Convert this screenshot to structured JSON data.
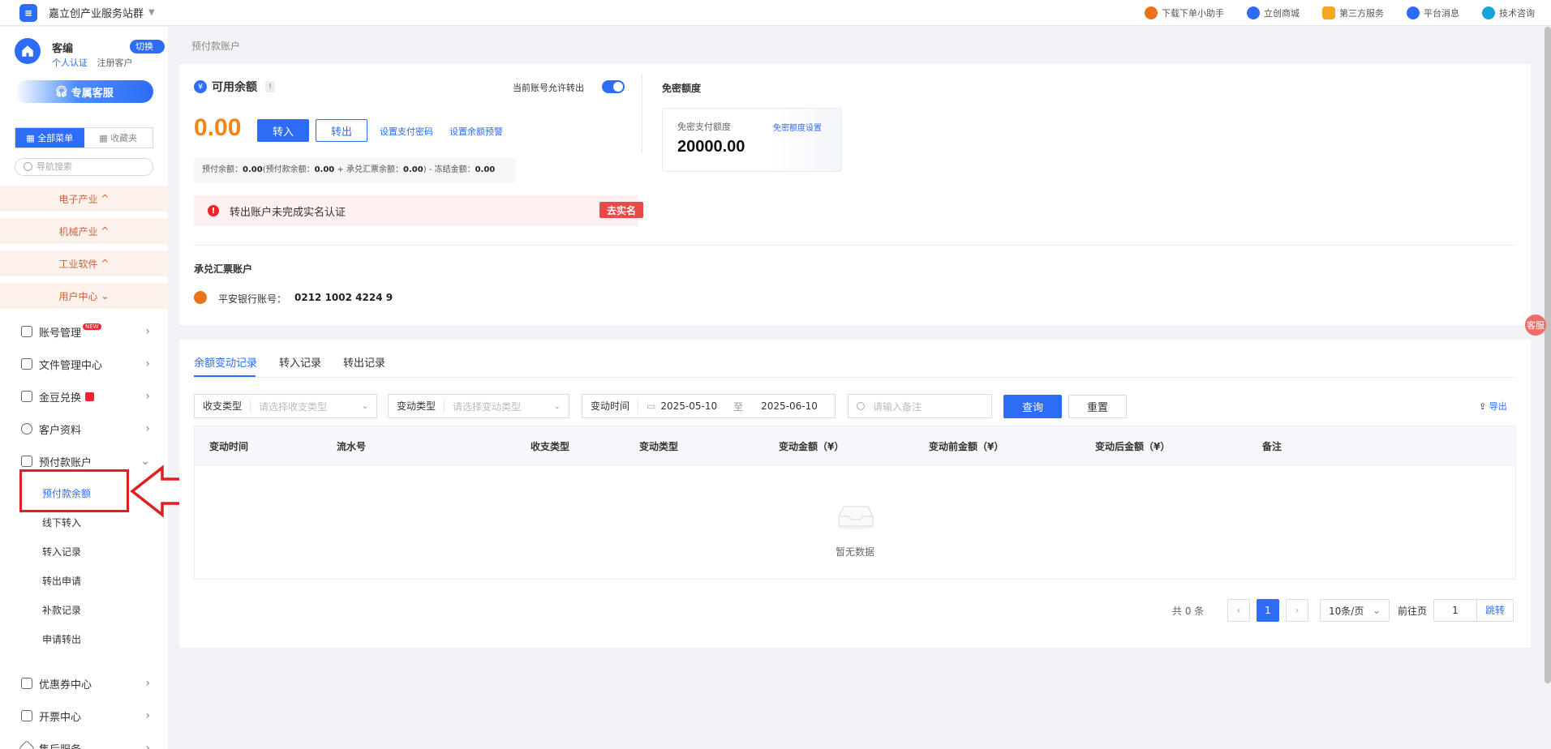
{
  "topbar": {
    "site_name": "嘉立创产业服务站群",
    "links": [
      {
        "label": "下载下单小助手",
        "color": "#e8741c",
        "icon": "assistant-icon"
      },
      {
        "label": "立创商城",
        "color": "#2d6cf6",
        "icon": "mall-icon"
      },
      {
        "label": "第三方服务",
        "color": "#f5a623",
        "icon": "apps-icon"
      },
      {
        "label": "平台消息",
        "color": "#2d6cf6",
        "icon": "bell-icon"
      },
      {
        "label": "技术咨询",
        "color": "#17a2d8",
        "icon": "chat-icon"
      }
    ]
  },
  "sidebar": {
    "user_name": "客编",
    "switch_label": "切换",
    "tag_personal": "个人认证",
    "tag_registered": "注册客户",
    "vip_label": "专属客服",
    "menu_all": "全部菜单",
    "menu_fav": "收藏夹",
    "search_placeholder": "导航搜索",
    "categories": [
      "电子产业",
      "机械产业",
      "工业软件",
      "用户中心"
    ],
    "items": [
      {
        "label": "账号管理",
        "badge": "NEW"
      },
      {
        "label": "文件管理中心"
      },
      {
        "label": "金豆兑换"
      },
      {
        "label": "客户资料"
      },
      {
        "label": "预付款账户"
      },
      {
        "label": "优惠券中心"
      },
      {
        "label": "开票中心"
      },
      {
        "label": "售后服务"
      }
    ],
    "sub_items": [
      "预付款余额",
      "线下转入",
      "转入记录",
      "转出申请",
      "补款记录",
      "申请转出"
    ]
  },
  "main": {
    "breadcrumb": "预付款账户",
    "available_title": "可用余额",
    "allow_transfer_label": "当前账号允许转出",
    "allow_transfer_on": true,
    "balance": "0.00",
    "transfer_in": "转入",
    "transfer_out": "转出",
    "set_pay_password": "设置支付密码",
    "set_balance_alert": "设置余额预警",
    "formula": {
      "p1": "预付余额：",
      "v1": "0.00",
      "p2": "(预付款余额：",
      "v2": "0.00",
      "p3": " + 承兑汇票余额：",
      "v3": "0.00",
      "p4": ") - 冻结金额：",
      "v4": "0.00"
    },
    "warning_text": "转出账户未完成实名认证",
    "verify_button": "去实名",
    "free_title": "免密额度",
    "free_label": "免密支付额度",
    "free_setting": "免密额度设置",
    "free_value": "20000.00",
    "acceptance_title": "承兑汇票账户",
    "bank_label": "平安银行账号：",
    "bank_no": "0212 1002 4224 9"
  },
  "records": {
    "tabs": [
      "余额变动记录",
      "转入记录",
      "转出记录"
    ],
    "filters": {
      "income_label": "收支类型",
      "income_placeholder": "请选择收支类型",
      "change_label": "变动类型",
      "change_placeholder": "请选择变动类型",
      "time_label": "变动时间",
      "date_from": "2025-05-10",
      "date_sep": "至",
      "date_to": "2025-06-10",
      "remark_placeholder": "请输入备注",
      "query": "查询",
      "reset": "重置",
      "export": "导出"
    },
    "columns": [
      "变动时间",
      "流水号",
      "收支类型",
      "变动类型",
      "变动金额（¥）",
      "变动前金额（¥）",
      "变动后金额（¥）",
      "备注"
    ],
    "empty_text": "暂无数据",
    "pagination": {
      "total": "共 0 条",
      "current": "1",
      "page_size": "10条/页",
      "goto_label": "前往页",
      "goto_value": "1",
      "jump": "跳转"
    }
  },
  "floating": {
    "label": "客服"
  }
}
